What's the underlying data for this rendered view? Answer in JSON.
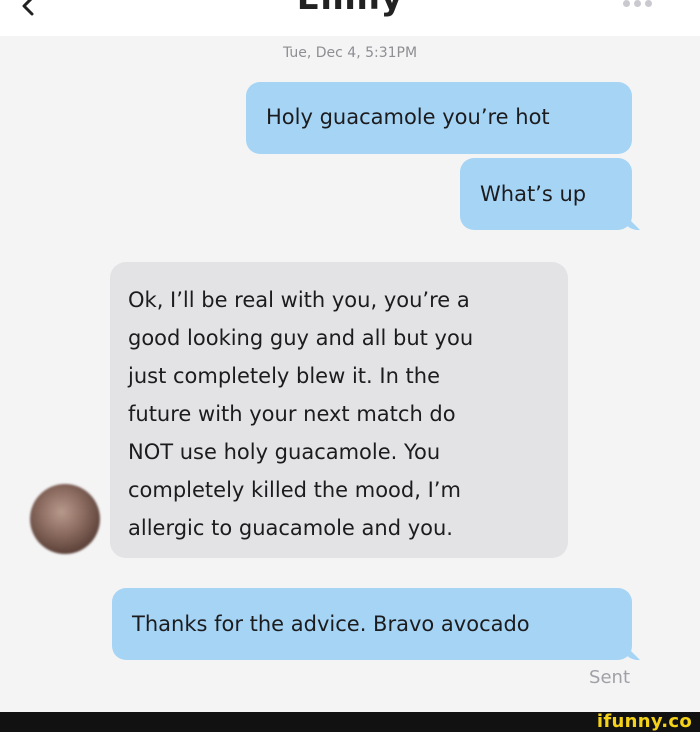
{
  "header": {
    "title": "Emily",
    "back_icon": "chevron-left-icon",
    "more_icon": "more-dots-icon"
  },
  "conversation": {
    "timestamp": "Tue, Dec 4, 5:31PM",
    "messages": [
      {
        "direction": "outgoing",
        "text": "Holy guacamole you’re hot"
      },
      {
        "direction": "outgoing",
        "text": "What’s up"
      },
      {
        "direction": "incoming",
        "lines": [
          "Ok, I’ll be real with you, you’re a",
          "good looking guy and all but you",
          "just completely blew it. In the",
          "future with your next match do",
          "NOT use holy guacamole. You",
          "completely killed the mood, I’m",
          "allergic to guacamole and you."
        ]
      },
      {
        "direction": "outgoing",
        "text": "Thanks for the advice. Bravo avocado"
      }
    ],
    "status": "Sent"
  },
  "watermark": {
    "text": "ifunny.co"
  },
  "colors": {
    "outgoing_bubble": "#a6d4f5",
    "incoming_bubble": "#e3e3e6",
    "background": "#f4f4f5",
    "watermark": "#f5d21a"
  }
}
